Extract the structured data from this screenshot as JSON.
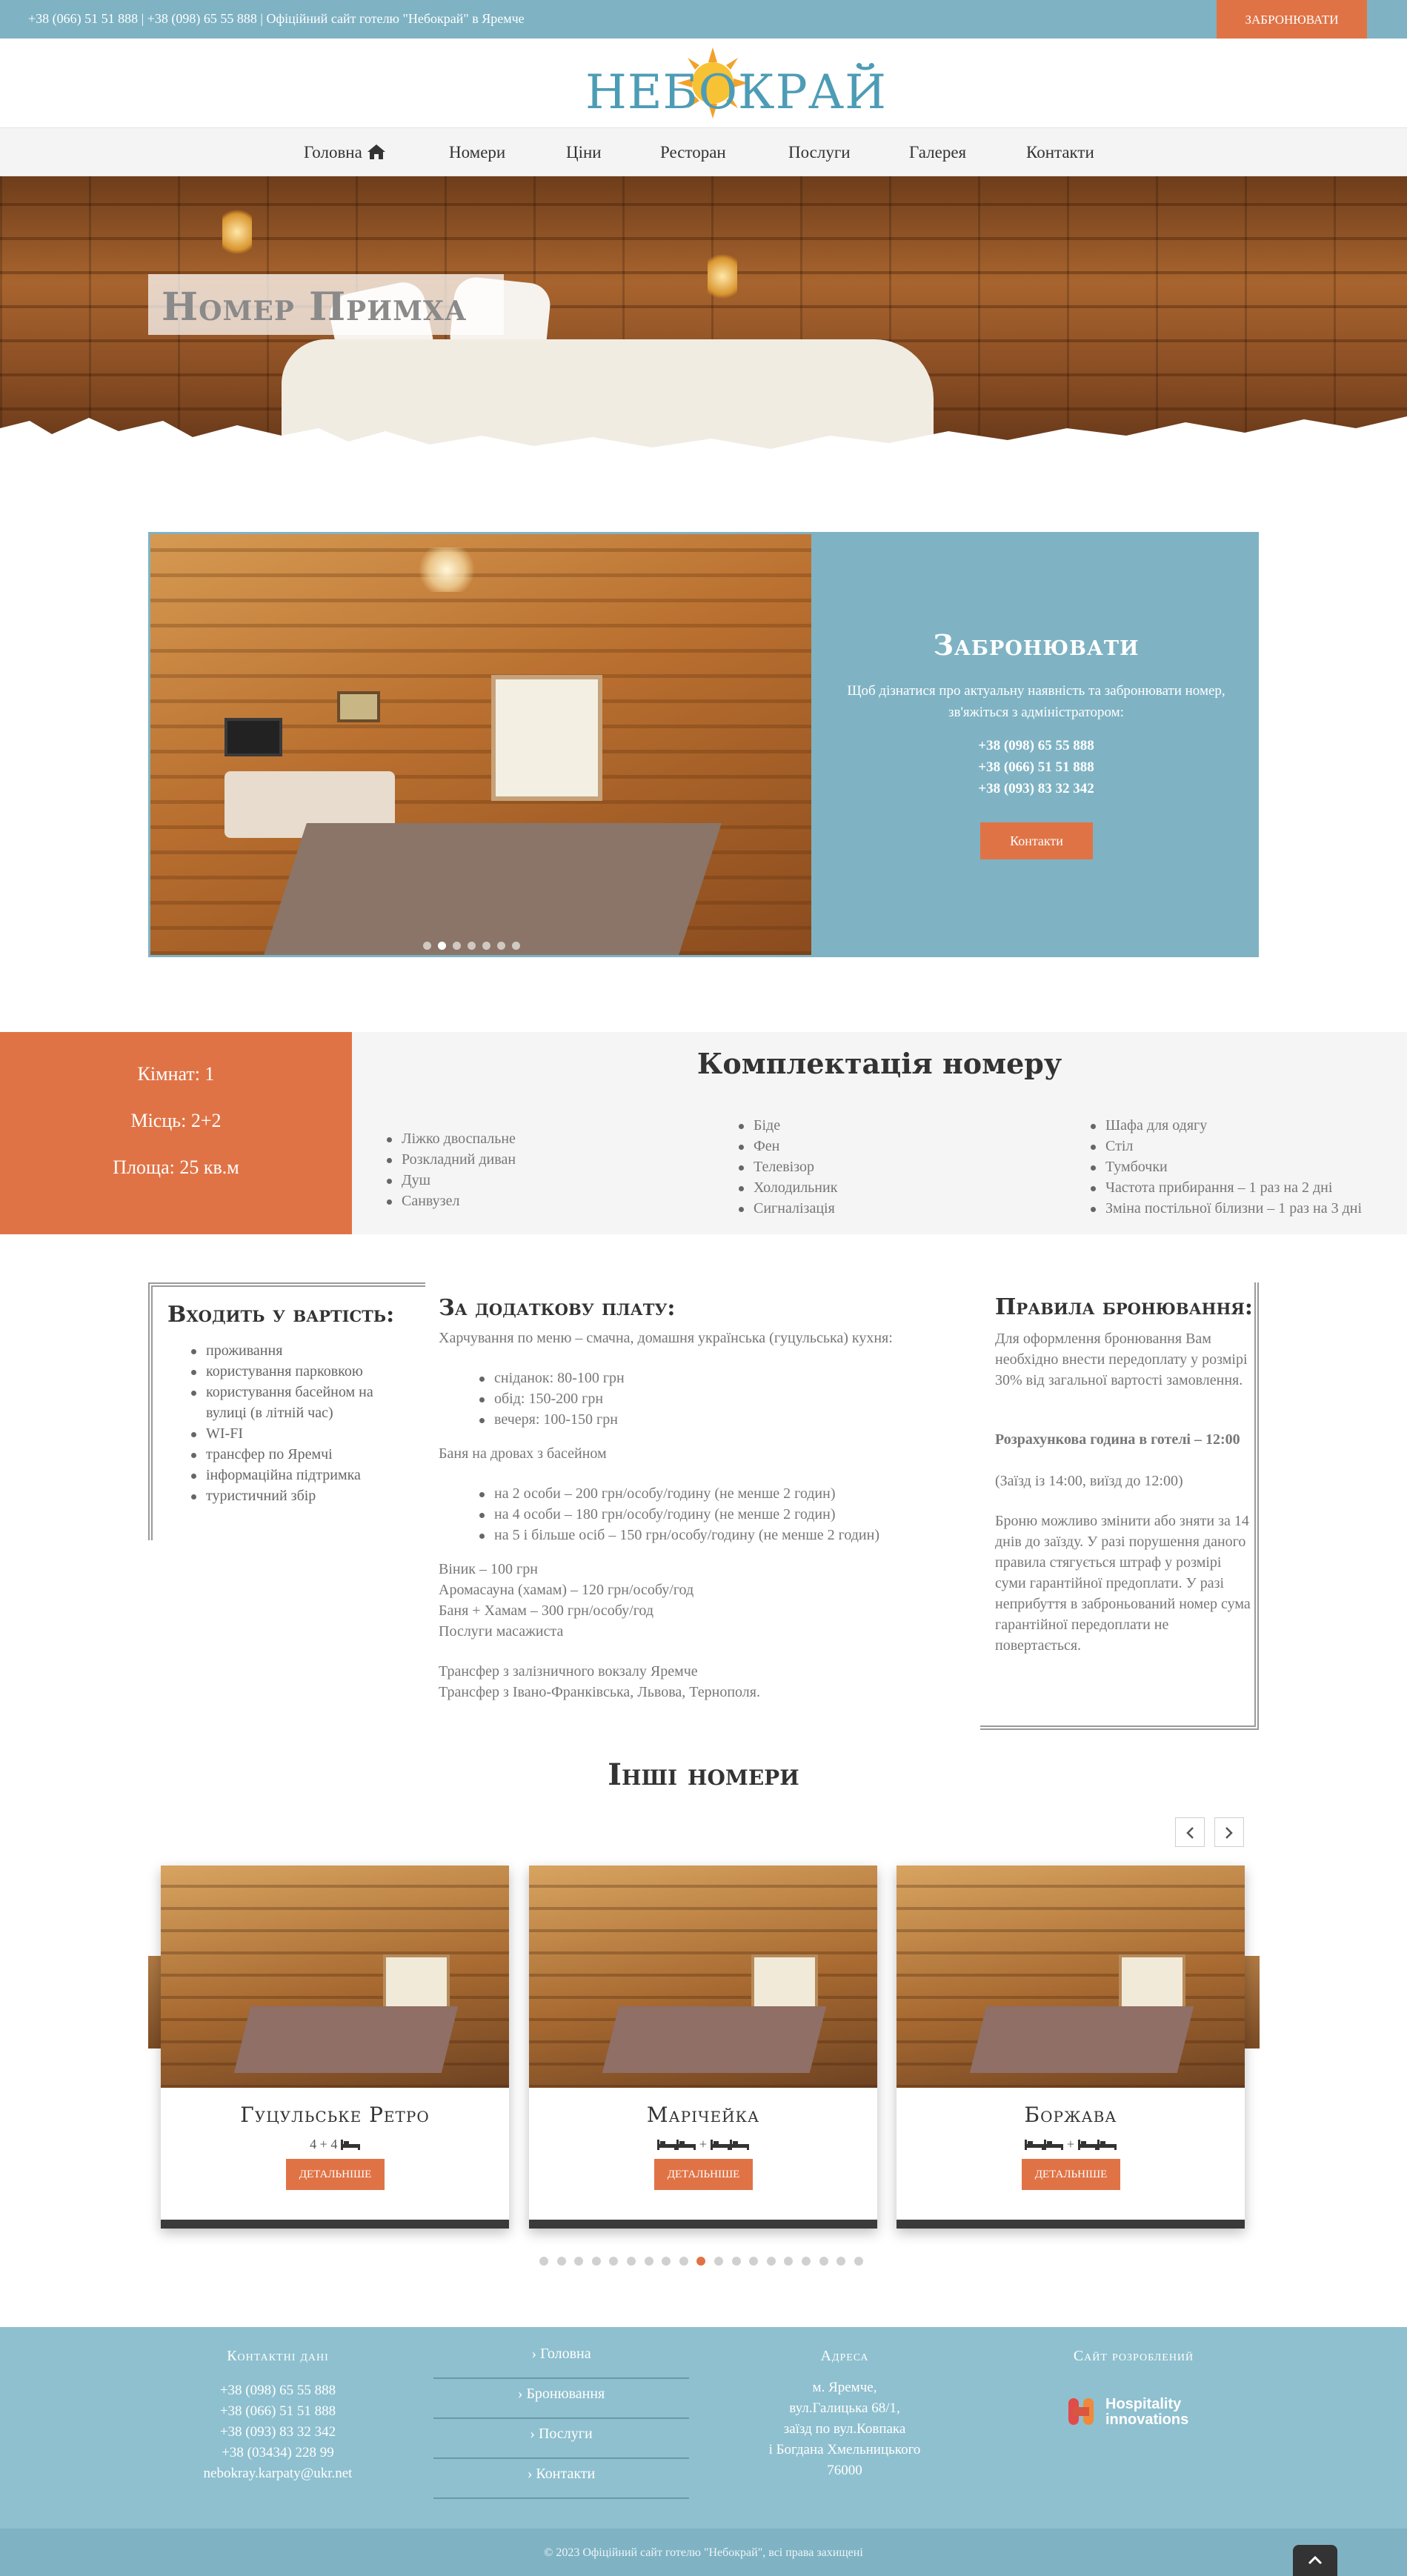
{
  "topbar": {
    "info": "+38 (066) 51 51 888 | +38 (098) 65 55 888 | Офіційний сайт готелю \"Небокрай\" в Яремче",
    "book_button": "ЗАБРОНЮВАТИ"
  },
  "logo": {
    "text": "НЕБОКРАЙ"
  },
  "nav": {
    "items": [
      "Головна",
      "Номери",
      "Ціни",
      "Ресторан",
      "Послуги",
      "Галерея",
      "Контакти"
    ]
  },
  "hero": {
    "title": "Номер Примха"
  },
  "booking": {
    "title": "Забронювати",
    "text": "Щоб дізнатися про актуальну наявність та забронювати номер, зв'яжіться з адміністратором:",
    "phones": [
      "+38 (098) 65 55 888",
      "+38 (066) 51 51 888",
      "+38 (093) 83 32 342"
    ],
    "button": "Контакти",
    "slide_count": 7,
    "active_slide": 1
  },
  "room_stats": {
    "rooms": "Кімнат: 1",
    "places": "Місць: 2+2",
    "area": "Площа: 25 кв.м"
  },
  "equipment": {
    "title": "Комплектація номеру",
    "col1": [
      "Ліжко двоспальне",
      "Розкладний диван",
      "Душ",
      "Санвузел"
    ],
    "col2": [
      "Біде",
      "Фен",
      "Телевізор",
      "Холодильник",
      "Сигналізація"
    ],
    "col3": [
      "Шафа для одягу",
      "Стіл",
      "Тумбочки",
      "Частота прибирання – 1 раз на 2 дні",
      "Зміна постільної білизни – 1 раз на 3 дні"
    ]
  },
  "included": {
    "title": "Входить у вартість:",
    "items": [
      "проживання",
      "користування парковкою",
      "користування басейном на вулиці (в літній час)",
      "WI-FI",
      "трансфер по Яремчі",
      "інформаційна підтримка",
      "туристичний збір"
    ]
  },
  "extra": {
    "title": "За додаткову плату:",
    "meals_intro": "Харчування по меню – смачна, домашня українська (гуцульська) кухня:",
    "meals": [
      "сніданок: 80-100 грн",
      "обід: 150-200 грн",
      "вечеря: 100-150 грн"
    ],
    "sauna_intro": "Баня на дровах з басейном",
    "sauna": [
      "на 2 особи – 200 грн/особу/годину (не менше 2 годин)",
      "на 4 особи – 180 грн/особу/годину (не менше 2 годин)",
      "на 5 і більше осіб – 150 грн/особу/годину (не менше 2 годин)"
    ],
    "other": [
      "Віник – 100 грн",
      "Аромасауна (хамам) – 120 грн/особу/год",
      "Баня + Хамам – 300 грн/особу/год",
      "Послуги масажиста"
    ],
    "transfer": [
      "Трансфер з залізничного вокзалу Яремче",
      "Трансфер з Івано-Франківська, Львова, Тернополя."
    ]
  },
  "rules": {
    "title": "Правила бронювання:",
    "prepay": "Для оформлення бронювання Вам необхідно внести передоплату у розмірі 30% від загальної вартості замовлення.",
    "checkout_bold": "Розрахункова година в готелі – 12:00",
    "checkout_note": "(Заїзд із 14:00, виїзд до 12:00)",
    "cancel": "Броню можливо змінити або зняти за 14 днів до заїзду. У разі порушення даного правила стягується штраф у розмірі суми гарантійної предоплати. У разі неприбуття в заброньований номер сума гарантійної передоплати не повертається."
  },
  "other_rooms": {
    "title": "Інші номери",
    "cards": [
      {
        "name": "Гуцульське Ретро",
        "beds": "4 + 4",
        "button": "ДЕТАЛЬНІШЕ"
      },
      {
        "name": "Марічейка",
        "beds": "+",
        "button": "ДЕТАЛЬНІШЕ"
      },
      {
        "name": "Боржава",
        "beds": "+",
        "button": "ДЕТАЛЬНІШЕ"
      }
    ],
    "dot_count": 19,
    "active_dot": 9
  },
  "footer": {
    "contacts_title": "Контактні дані",
    "contacts": [
      "+38 (098) 65 55 888",
      "+38 (066) 51 51 888",
      "+38 (093) 83 32 342",
      "+38 (03434) 228 99",
      "nebokray.karpaty@ukr.net"
    ],
    "menu": [
      "Головна",
      "Бронювання",
      "Послуги",
      "Контакти"
    ],
    "address_title": "Адреса",
    "address": [
      "м. Яремче,",
      "вул.Галицька 68/1,",
      "заїзд по вул.Ковпака",
      "і Богдана Хмельницького",
      "76000"
    ],
    "developer_title": "Сайт розроблений",
    "developer_line1": "Hospitality",
    "developer_line2": "innovations",
    "copyright": "© 2023 Офіційний сайт готелю \"Небокрай\", всі права захищені"
  },
  "colors": {
    "accent": "#e07346",
    "brand": "#7fb3c4",
    "footer": "#8fc0cf"
  }
}
